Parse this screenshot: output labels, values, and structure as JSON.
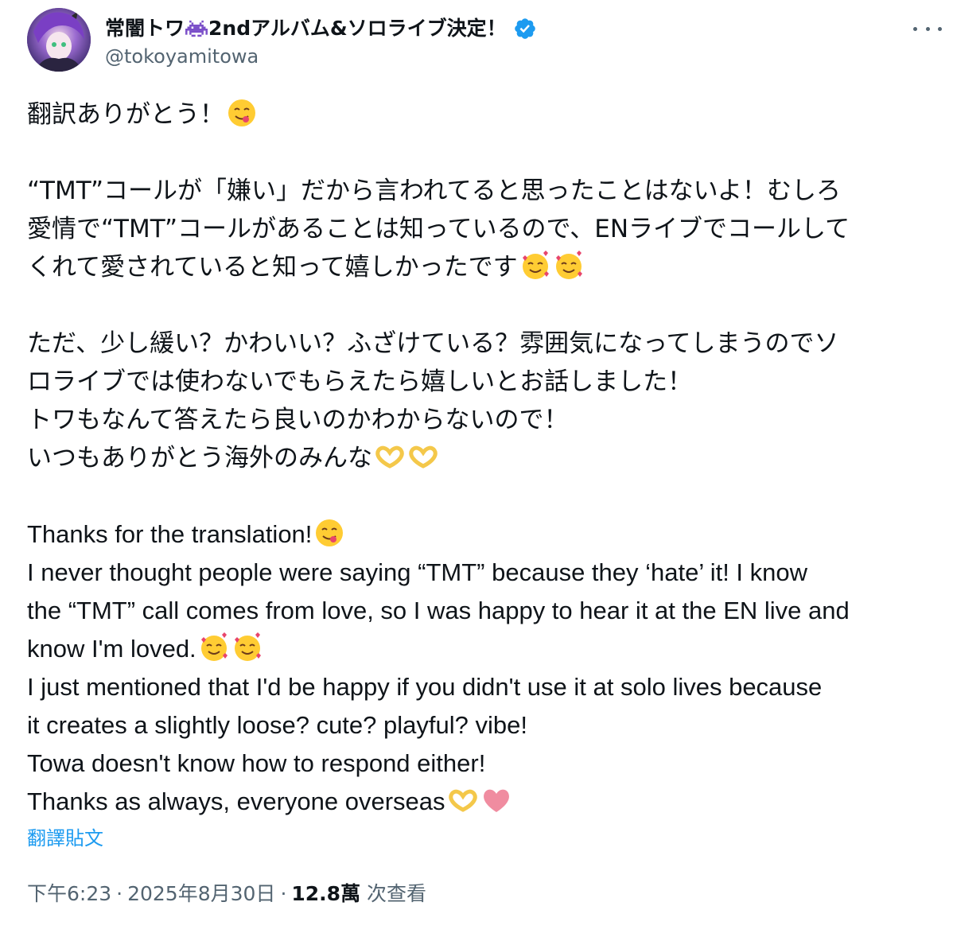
{
  "author": {
    "name_prefix": "常闇トワ",
    "name_suffix": "2ndアルバム&ソロライブ決定！",
    "handle": "@tokoyamitowa"
  },
  "tweet": {
    "ja_line1": "翻訳ありがとう！",
    "ja_p2_l1": "“TMT”コールが「嫌い」だから言われてると思ったことはないよ！むしろ",
    "ja_p2_l2": "愛情で“TMT”コールがあることは知っているので、ENライブでコールして",
    "ja_p2_l3": "くれて愛されていると知って嬉しかったです",
    "ja_p3_l1": "ただ、少し緩い？かわいい？ふざけている？雰囲気になってしまうのでソ",
    "ja_p3_l2": "ロライブでは使わないでもらえたら嬉しいとお話しました！",
    "ja_p3_l3": "トワもなんて答えたら良いのかわからないので！",
    "ja_p3_l4": "いつもありがとう海外のみんな",
    "en_l1": "Thanks for the translation!",
    "en_l2": "I never thought people were saying “TMT” because they ‘hate’ it! I know",
    "en_l3": "the “TMT” call comes from love, so I was happy to hear it at the EN live and",
    "en_l4": "know I'm loved.",
    "en_l5": "I just mentioned that I'd be happy if you didn't use it at solo lives because",
    "en_l6": "it creates a slightly loose? cute? playful? vibe!",
    "en_l7": "Towa doesn't know how to respond either!",
    "en_l8": "Thanks as always, everyone overseas"
  },
  "translate_label": "翻譯貼文",
  "meta": {
    "time": "下午6:23",
    "date": "2025年8月30日",
    "views_count": "12.8萬",
    "views_label": "次查看",
    "separator": "·"
  },
  "colors": {
    "link": "#1d9bf0",
    "secondary": "#536471",
    "verified": "#1d9bf0",
    "text": "#0f1419"
  },
  "icons": [
    "avatar",
    "space-invader-icon",
    "verified-badge-icon",
    "more-icon",
    "yum-emoji",
    "smiling-hearts-emoji",
    "heart-hands-emoji",
    "pink-heart-emoji"
  ]
}
